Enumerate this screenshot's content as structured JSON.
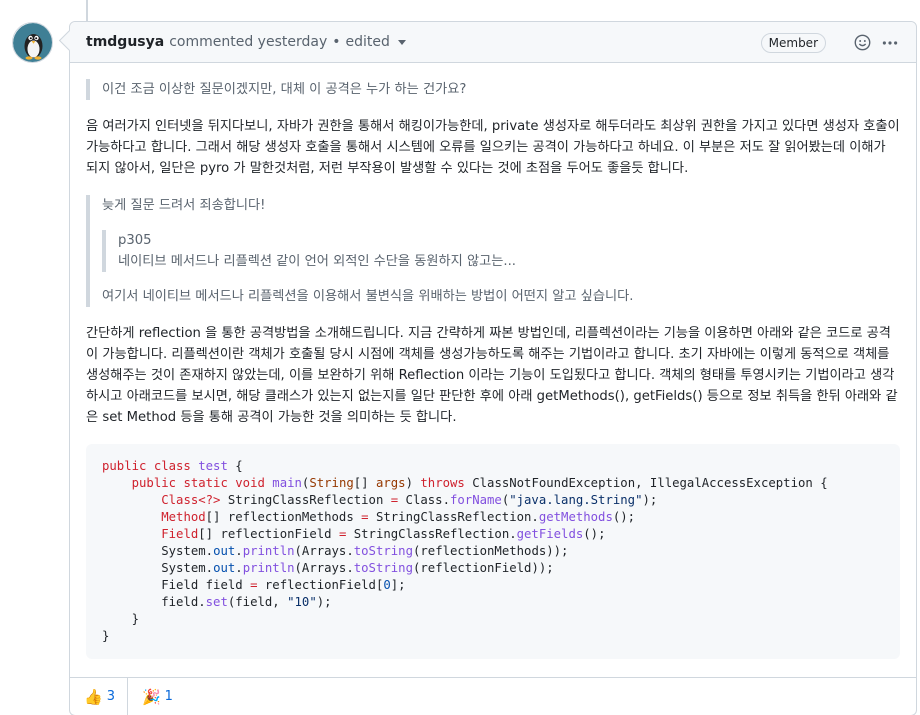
{
  "header": {
    "author": "tmdgusya",
    "action": "commented yesterday",
    "separator": "•",
    "edited": "edited",
    "badge": "Member"
  },
  "icons": {
    "avatar": "penguin-avatar",
    "emoji": "smiley-icon",
    "more": "kebab-icon"
  },
  "body": {
    "quote1": "이건 조금 이상한 질문이겠지만, 대체 이 공격은 누가 하는 건가요?",
    "para1": "음 여러가지 인터넷을 뒤지다보니, 자바가 권한을 통해서 해킹이가능한데, private 생성자로 해두더라도 최상위 권한을 가지고 있다면 생성자 호출이 가능하다고 합니다. 그래서 해당 생성자 호출을 통해서 시스템에 오류를 일으키는 공격이 가능하다고 하네요. 이 부분은 저도 잘 읽어봤는데 이해가 되지 않아서, 일단은 pyro 가 말한것처럼, 저런 부작용이 발생할 수 있다는 것에 초점을 두어도 좋을듯 합니다.",
    "quote2_line1": "늦게 질문 드려서 죄송합니다!",
    "quote2_nested_title": "p305",
    "quote2_nested_text": "네이티브 메서드나 리플렉션 같이 언어 외적인 수단을 동원하지 않고는...",
    "quote2_line2": "여기서 네이티브 메서드나 리플렉션을 이용해서 불변식을 위배하는 방법이 어떤지 알고 싶습니다.",
    "para2": "간단하게 reflection 을 통한 공격방법을 소개해드립니다. 지금 간략하게 짜본 방법인데, 리플렉션이라는 기능을 이용하면 아래와 같은 코드로 공격이 가능합니다. 리플렉션이란 객체가 호출될 당시 시점에 객체를 생성가능하도록 해주는 기법이라고 합니다. 초기 자바에는 이렇게 동적으로 객체를 생성해주는 것이 존재하지 않았는데, 이를 보완하기 위해 Reflection 이라는 기능이 도입됬다고 합니다. 객체의 형태를 투영시키는 기법이라고 생각하시고 아래코드를 보시면, 해당 클래스가 있는지 없는지를 일단 판단한 후에 아래 getMethods(), getFields() 등으로 정보 취득을 한뒤 아래와 같은 set Method 등을 통해 공격이 가능한 것을 의미하는 듯 합니다."
  },
  "code": {
    "l1": "public class test {",
    "l2": "    public static void main(String[] args) throws ClassNotFoundException, IllegalAccessException {",
    "l3": "        Class<?> StringClassReflection = Class.forName(\"java.lang.String\");",
    "l4": "        Method[] reflectionMethods = StringClassReflection.getMethods();",
    "l5": "        Field[] reflectionField = StringClassReflection.getFields();",
    "l6": "        System.out.println(Arrays.toString(reflectionMethods));",
    "l7": "        System.out.println(Arrays.toString(reflectionField));",
    "l8": "        Field field = reflectionField[0];",
    "l9": "        field.set(field, \"10\");",
    "l10": "    }",
    "l11": "}"
  },
  "reactions": [
    {
      "emoji": "👍",
      "count": "3"
    },
    {
      "emoji": "🎉",
      "count": "1"
    }
  ]
}
